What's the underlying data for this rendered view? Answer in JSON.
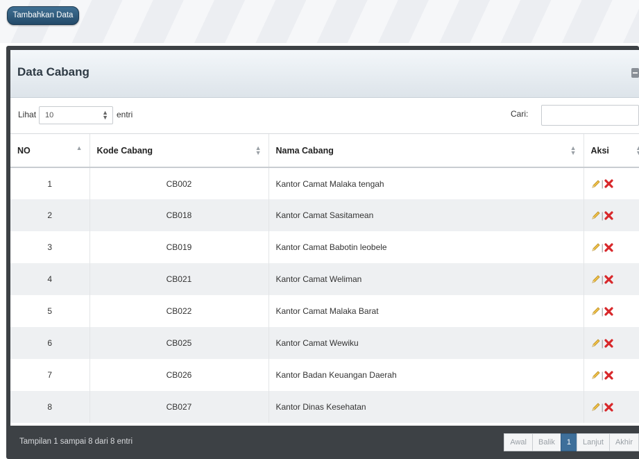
{
  "toolbar": {
    "add_label": "Tambahkan Data"
  },
  "panel": {
    "title": "Data Cabang"
  },
  "controls": {
    "show_label": "Lihat",
    "page_length": "10",
    "entries_label": "entri",
    "search_label": "Cari:",
    "search_value": ""
  },
  "table": {
    "headers": {
      "no": "NO",
      "kode": "Kode Cabang",
      "nama": "Nama Cabang",
      "aksi": "Aksi"
    },
    "rows": [
      {
        "no": "1",
        "kode": "CB002",
        "nama": "Kantor Camat Malaka tengah"
      },
      {
        "no": "2",
        "kode": "CB018",
        "nama": "Kantor Camat Sasitamean"
      },
      {
        "no": "3",
        "kode": "CB019",
        "nama": "Kantor Camat Babotin leobele"
      },
      {
        "no": "4",
        "kode": "CB021",
        "nama": "Kantor Camat Weliman"
      },
      {
        "no": "5",
        "kode": "CB022",
        "nama": "Kantor Camat Malaka Barat"
      },
      {
        "no": "6",
        "kode": "CB025",
        "nama": "Kantor Camat Wewiku"
      },
      {
        "no": "7",
        "kode": "CB026",
        "nama": "Kantor Badan Keuangan Daerah"
      },
      {
        "no": "8",
        "kode": "CB027",
        "nama": "Kantor Dinas Kesehatan"
      }
    ],
    "action_icons": [
      "pencil-icon",
      "delete-x-icon"
    ]
  },
  "footer": {
    "info": "Tampilan 1 sampai 8 dari 8 entri",
    "pager": {
      "first": "Awal",
      "prev": "Balik",
      "current": "1",
      "next": "Lanjut",
      "last": "Akhir"
    }
  },
  "colors": {
    "button": "#2f5a7d",
    "panel_frame": "#3d4145",
    "active_page": "#3e6f9a",
    "delete": "#d8282b",
    "edit": "#e8b83a"
  }
}
